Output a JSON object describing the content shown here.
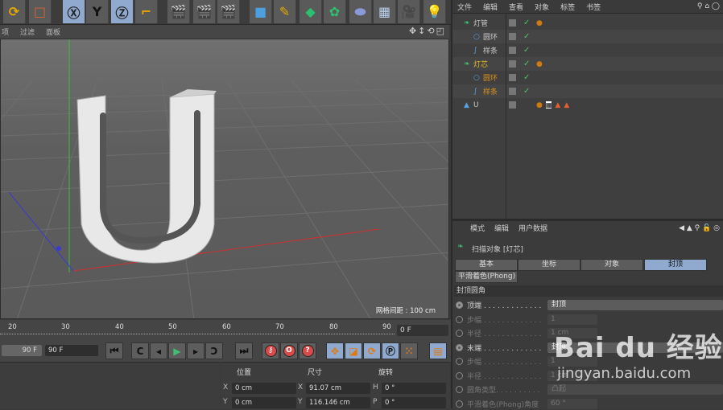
{
  "toolbar": {
    "y_axis_label": "Y",
    "x_axis_label": "X",
    "z_axis_label": "Z"
  },
  "viewport": {
    "menu": [
      "项",
      "过滤",
      "面板"
    ],
    "grid_spacing": "网格间距 : 100 cm"
  },
  "timeline": {
    "ticks": [
      "20",
      "30",
      "40",
      "50",
      "60",
      "70",
      "80",
      "90"
    ],
    "current_frame": "0 F",
    "start_frame": "90 F",
    "end_frame": "90 F"
  },
  "coords": {
    "headers": [
      "位置",
      "尺寸",
      "旋转"
    ],
    "rows": [
      {
        "axis": "X",
        "pos": "0 cm",
        "size_axis": "X",
        "size": "91.07 cm",
        "rot_axis": "H",
        "rot": "0 °"
      },
      {
        "axis": "Y",
        "pos": "0 cm",
        "size_axis": "Y",
        "size": "116.146 cm",
        "rot_axis": "P",
        "rot": "0 °"
      }
    ]
  },
  "object_manager": {
    "menu": [
      "文件",
      "编辑",
      "查看",
      "对象",
      "标签",
      "书签"
    ],
    "objects": [
      {
        "name": "灯管",
        "color": "#c8c8c8"
      },
      {
        "name": "圆环",
        "color": "#c8c8c8"
      },
      {
        "name": "样条",
        "color": "#c8c8c8"
      },
      {
        "name": "灯芯",
        "color": "#e8b923"
      },
      {
        "name": "圆环",
        "color": "#d9901a"
      },
      {
        "name": "样条",
        "color": "#d9901a"
      },
      {
        "name": "U",
        "color": "#c8c8c8"
      }
    ]
  },
  "attributes": {
    "menu": [
      "模式",
      "编辑",
      "用户数据"
    ],
    "title": "扫描对象 [灯芯]",
    "tabs": [
      "基本",
      "坐标",
      "对象",
      "封顶",
      "平滑着色(Phong)"
    ],
    "active_tab": "封顶",
    "section": "封顶圆角",
    "fields": [
      {
        "label": "顶端 . . . . . . . . . . . . .",
        "value": "封顶",
        "type": "dropdown"
      },
      {
        "label": "步幅 . . . . . . . . . . . . .",
        "value": "1",
        "type": "number"
      },
      {
        "label": "半径 . . . . . . . . . . . . .",
        "value": "1 cm",
        "type": "number"
      },
      {
        "label": "末端 . . . . . . . . . . . . .",
        "value": "封顶",
        "type": "dropdown"
      },
      {
        "label": "步幅 . . . . . . . . . . . . .",
        "value": "1",
        "type": "number"
      },
      {
        "label": "半径 . . . . . . . . . . . . .",
        "value": "1 cm",
        "type": "number"
      },
      {
        "label": "圆角类型. . . . . . . . . .",
        "value": "凸起",
        "type": "dropdown"
      },
      {
        "label": "平滑着色(Phong)角度",
        "value": "60 °",
        "type": "number"
      }
    ]
  },
  "watermark": {
    "brand": "Bai du 经验",
    "url": "jingyan.baidu.com"
  }
}
